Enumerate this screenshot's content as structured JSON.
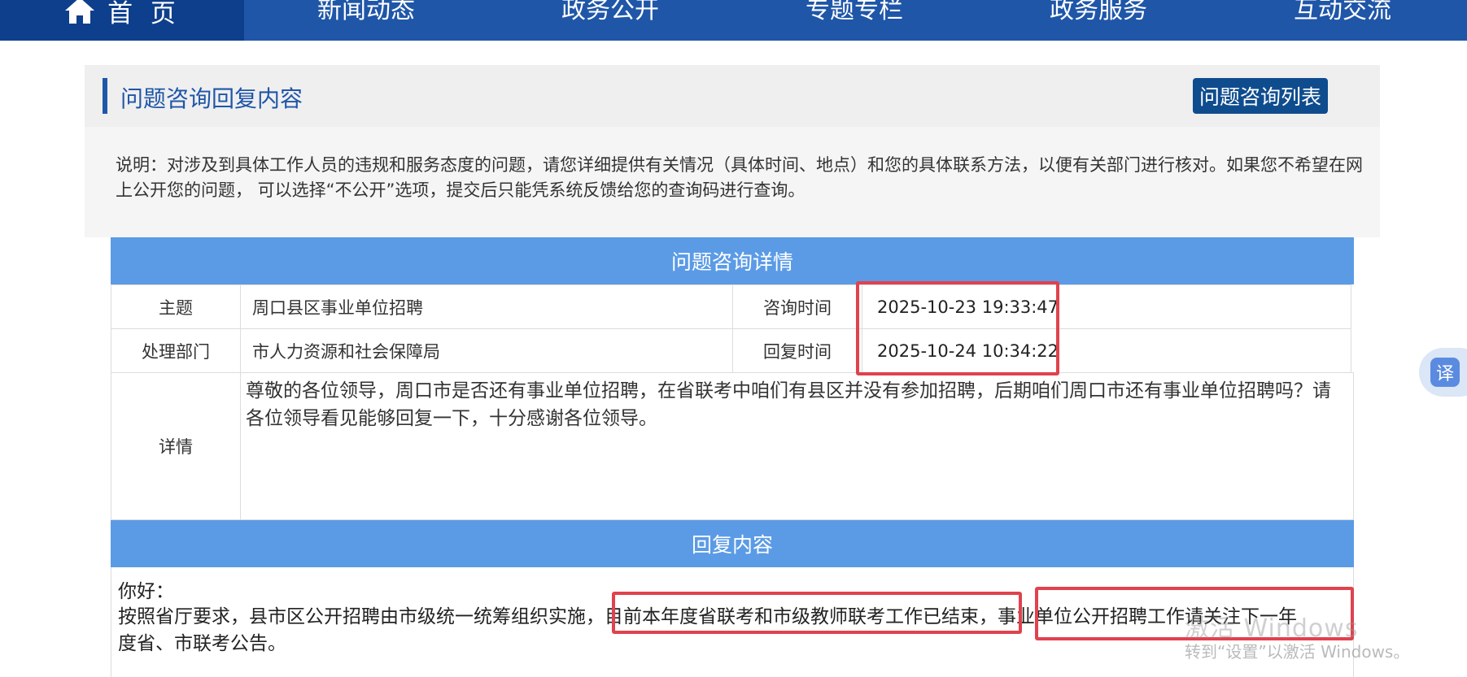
{
  "nav": {
    "home_label": "首 页",
    "items": [
      "新闻动态",
      "政务公开",
      "专题专栏",
      "政务服务",
      "互动交流"
    ]
  },
  "panel": {
    "title": "问题咨询回复内容",
    "list_button": "问题咨询列表",
    "note": "说明：对涉及到具体工作人员的违规和服务态度的问题，请您详细提供有关情况（具体时间、地点）和您的具体联系方法，以便有关部门进行核对。如果您不希望在网上公开您的问题， 可以选择“不公开”选项，提交后只能凭系统反馈给您的查询码进行查询。"
  },
  "detail": {
    "header": "问题咨询详情",
    "subject_label": "主题",
    "subject_value": "周口县区事业单位招聘",
    "ask_time_label": "咨询时间",
    "ask_time_value": "2025-10-23 19:33:47",
    "dept_label": "处理部门",
    "dept_value": "市人力资源和社会保障局",
    "reply_time_label": "回复时间",
    "reply_time_value": "2025-10-24 10:34:22",
    "detail_label": "详情",
    "detail_text": "尊敬的各位领导，周口市是否还有事业单位招聘，在省联考中咱们有县区并没有参加招聘，后期咱们周口市还有事业单位招聘吗？请各位领导看见能够回复一下，十分感谢各位领导。"
  },
  "reply": {
    "header": "回复内容",
    "greeting": "你好：",
    "body_part1": "按照省厅要求，县市区公开招聘由市级统一统筹组织实施，",
    "body_part2": "目前本年度省联考和市级教师联考工作已结束",
    "body_part3": "，",
    "body_part4": "事业单位公开招聘工作请关注下一年",
    "body_part5": "度省、市联考公告。"
  },
  "side": {
    "translate_label": "译"
  },
  "watermark": {
    "line1": "激活 Windows",
    "line2": "转到“设置”以激活 Windows。"
  },
  "colors": {
    "nav_bg": "#1f56a8",
    "nav_home_bg": "#0d3f8c",
    "section_header": "#5b9be6",
    "highlight_border": "#e0424e"
  }
}
